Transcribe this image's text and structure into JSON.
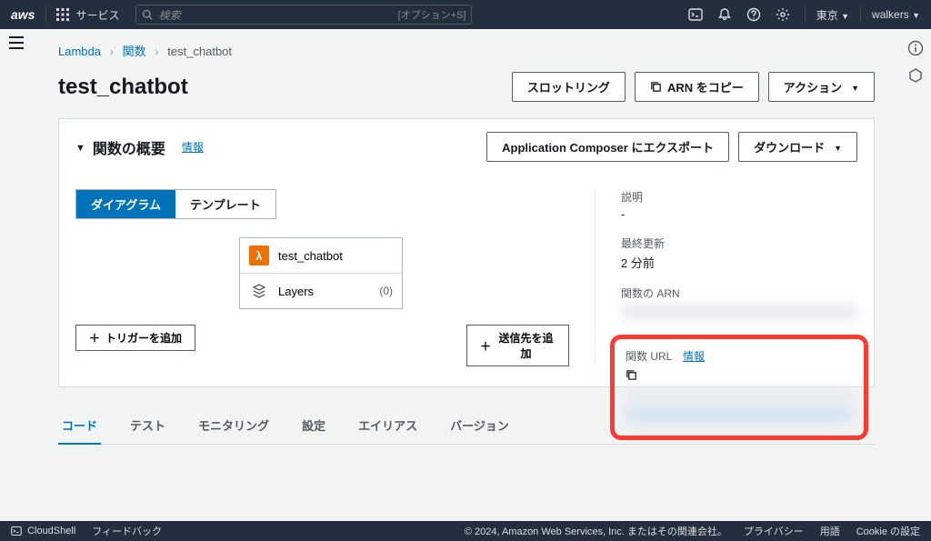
{
  "topnav": {
    "logo": "aws",
    "services": "サービス",
    "search_placeholder": "検索",
    "search_kbd": "[オプション+S]",
    "region": "東京",
    "account": "walkers"
  },
  "breadcrumb": {
    "root": "Lambda",
    "funcs": "関数",
    "current": "test_chatbot"
  },
  "page": {
    "title": "test_chatbot",
    "throttling": "スロットリング",
    "copy_arn": "ARN をコピー",
    "actions": "アクション"
  },
  "overview": {
    "title": "関数の概要",
    "info": "情報",
    "export": "Application Composer にエクスポート",
    "download": "ダウンロード",
    "tabs": {
      "diagram": "ダイアグラム",
      "template": "テンプレート"
    },
    "fn_name": "test_chatbot",
    "layers": "Layers",
    "layers_count": "(0)",
    "add_trigger": "トリガーを追加",
    "add_destination": "送信先を追加"
  },
  "meta": {
    "desc_label": "説明",
    "desc_val": "-",
    "updated_label": "最終更新",
    "updated_val": "2 分前",
    "arn_label": "関数の ARN",
    "url_label": "関数 URL",
    "url_info": "情報"
  },
  "bottom_tabs": {
    "code": "コード",
    "test": "テスト",
    "monitoring": "モニタリング",
    "settings": "設定",
    "aliases": "エイリアス",
    "versions": "バージョン"
  },
  "footer": {
    "cloudshell": "CloudShell",
    "feedback": "フィードバック",
    "copyright": "© 2024, Amazon Web Services, Inc. またはその関連会社。",
    "privacy": "プライバシー",
    "terms": "用語",
    "cookies": "Cookie の設定"
  }
}
